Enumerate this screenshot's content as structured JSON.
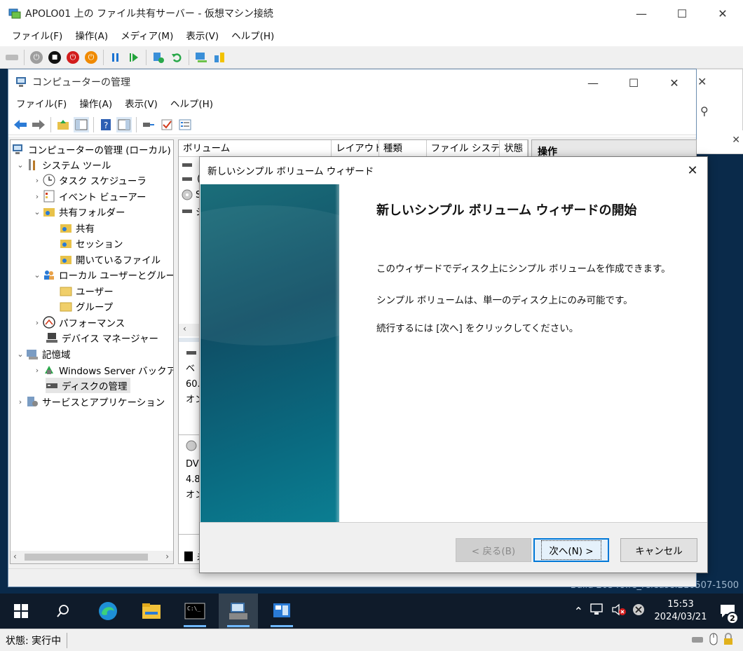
{
  "vm_window": {
    "title": "APOLO01 上の ファイル共有サーバー - 仮想マシン接続",
    "menu": [
      "ファイル(F)",
      "操作(A)",
      "メディア(M)",
      "表示(V)",
      "ヘルプ(H)"
    ],
    "status_label": "状態: 実行中"
  },
  "computer_management": {
    "title": "コンピューターの管理",
    "menu": [
      "ファイル(F)",
      "操作(A)",
      "表示(V)",
      "ヘルプ(H)"
    ],
    "tree": {
      "root": "コンピューターの管理 (ローカル)",
      "system_tools": "システム ツール",
      "task_scheduler": "タスク スケジューラ",
      "event_viewer": "イベント ビューアー",
      "shared_folders": "共有フォルダー",
      "shares": "共有",
      "sessions": "セッション",
      "open_files": "開いているファイル",
      "local_users_groups": "ローカル ユーザーとグループ",
      "users": "ユーザー",
      "groups": "グループ",
      "performance": "パフォーマンス",
      "device_manager": "デバイス マネージャー",
      "storage": "記憶域",
      "windows_server_backup": "Windows Server バックアップ",
      "disk_management": "ディスクの管理",
      "services_apps": "サービスとアプリケーション"
    },
    "volume_columns": [
      "ボリューム",
      "レイアウト",
      "種類",
      "ファイル システム",
      "状態"
    ],
    "volume_fragments": [
      "(",
      "S",
      "シ"
    ],
    "disk0_fragments": [
      "ベ",
      "60.",
      "オン"
    ],
    "disk1_fragments": [
      "DV",
      "4.8",
      "オン"
    ],
    "legend_fragment": "未",
    "action_pane_title": "操作"
  },
  "wizard": {
    "title": "新しいシンプル ボリューム ウィザード",
    "heading": "新しいシンプル ボリューム ウィザードの開始",
    "paragraphs": [
      "このウィザードでディスク上にシンプル ボリュームを作成できます。",
      "シンプル ボリュームは、単一のディスク上にのみ可能です。",
      "続行するには [次へ] をクリックしてください。"
    ],
    "back_label": "< 戻る(B)",
    "next_label": "次へ(N) >",
    "cancel_label": "キャンセル"
  },
  "desktop": {
    "build_text": "Build 20348.fe_release.210507-1500"
  },
  "taskbar": {
    "time": "15:53",
    "date": "2024/03/21",
    "notification_count": "2"
  },
  "colors": {
    "accent": "#0078d7",
    "taskbar": "#0f1b2a",
    "wizard_panel": "#0f4f66"
  }
}
